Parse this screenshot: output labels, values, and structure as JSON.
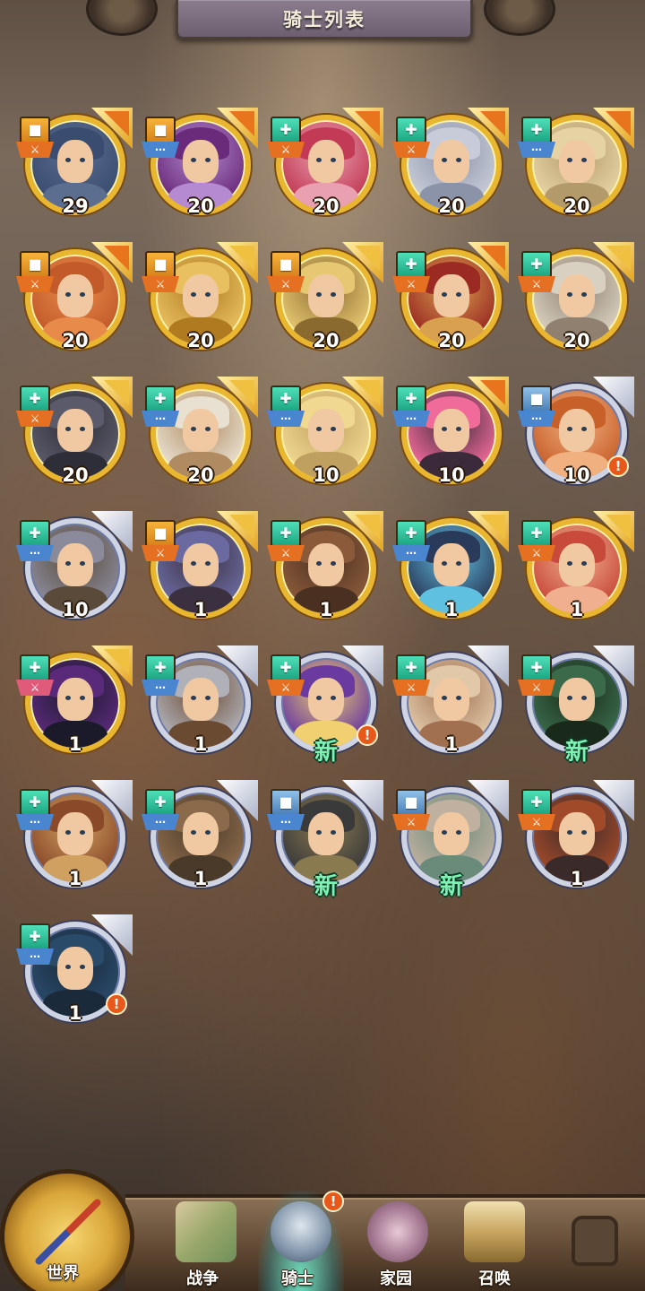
{
  "header": {
    "title": "骑士列表"
  },
  "knights": [
    {
      "level": "29",
      "frame": "gold",
      "class": "gold",
      "role": "orange",
      "corner": "orange",
      "alert": false
    },
    {
      "level": "20",
      "frame": "gold",
      "class": "gold",
      "role": "blue",
      "corner": "orange",
      "alert": false
    },
    {
      "level": "20",
      "frame": "gold",
      "class": "teal",
      "role": "orange",
      "corner": "orange",
      "alert": false
    },
    {
      "level": "20",
      "frame": "gold",
      "class": "teal",
      "role": "orange",
      "corner": "orange",
      "alert": false
    },
    {
      "level": "20",
      "frame": "gold",
      "class": "teal",
      "role": "blue",
      "corner": "orange",
      "alert": false
    },
    {
      "level": "20",
      "frame": "gold",
      "class": "gold",
      "role": "orange",
      "corner": "orange",
      "alert": false
    },
    {
      "level": "20",
      "frame": "gold",
      "class": "gold",
      "role": "orange",
      "corner": "yellow",
      "alert": false
    },
    {
      "level": "20",
      "frame": "gold",
      "class": "gold",
      "role": "orange",
      "corner": "yellow",
      "alert": false
    },
    {
      "level": "20",
      "frame": "gold",
      "class": "teal",
      "role": "orange",
      "corner": "orange",
      "alert": false
    },
    {
      "level": "20",
      "frame": "gold",
      "class": "teal",
      "role": "orange",
      "corner": "yellow",
      "alert": false
    },
    {
      "level": "20",
      "frame": "gold",
      "class": "teal",
      "role": "orange",
      "corner": "yellow",
      "alert": false
    },
    {
      "level": "20",
      "frame": "gold",
      "class": "teal",
      "role": "blue",
      "corner": "yellow",
      "alert": false
    },
    {
      "level": "10",
      "frame": "gold",
      "class": "teal",
      "role": "blue",
      "corner": "yellow",
      "alert": false
    },
    {
      "level": "10",
      "frame": "gold",
      "class": "teal",
      "role": "blue",
      "corner": "orange",
      "alert": false
    },
    {
      "level": "10",
      "frame": "blue",
      "class": "blue",
      "role": "blue",
      "corner": "none",
      "alert": true
    },
    {
      "level": "10",
      "frame": "blue",
      "class": "teal",
      "role": "blue",
      "corner": "none",
      "alert": false
    },
    {
      "level": "1",
      "frame": "gold",
      "class": "gold",
      "role": "orange",
      "corner": "yellow",
      "alert": false
    },
    {
      "level": "1",
      "frame": "gold",
      "class": "teal",
      "role": "orange",
      "corner": "yellow",
      "alert": false
    },
    {
      "level": "1",
      "frame": "gold",
      "class": "teal",
      "role": "blue",
      "corner": "yellow",
      "alert": false
    },
    {
      "level": "1",
      "frame": "gold",
      "class": "teal",
      "role": "orange",
      "corner": "yellow",
      "alert": false
    },
    {
      "level": "1",
      "frame": "gold",
      "class": "teal",
      "role": "pink",
      "corner": "yellow",
      "alert": false
    },
    {
      "level": "1",
      "frame": "blue",
      "class": "teal",
      "role": "blue",
      "corner": "none",
      "alert": false
    },
    {
      "level": "新",
      "frame": "blue",
      "class": "teal",
      "role": "orange",
      "corner": "none",
      "alert": true
    },
    {
      "level": "1",
      "frame": "blue",
      "class": "teal",
      "role": "orange",
      "corner": "none",
      "alert": false
    },
    {
      "level": "新",
      "frame": "blue",
      "class": "teal",
      "role": "orange",
      "corner": "none",
      "alert": false
    },
    {
      "level": "1",
      "frame": "blue",
      "class": "teal",
      "role": "blue",
      "corner": "none",
      "alert": false
    },
    {
      "level": "1",
      "frame": "blue",
      "class": "teal",
      "role": "blue",
      "corner": "none",
      "alert": false
    },
    {
      "level": "新",
      "frame": "blue",
      "class": "blue",
      "role": "blue",
      "corner": "none",
      "alert": false
    },
    {
      "level": "新",
      "frame": "blue",
      "class": "blue",
      "role": "orange",
      "corner": "none",
      "alert": false
    },
    {
      "level": "1",
      "frame": "blue",
      "class": "teal",
      "role": "orange",
      "corner": "none",
      "alert": false
    },
    {
      "level": "1",
      "frame": "blue",
      "class": "teal",
      "role": "blue",
      "corner": "none",
      "alert": true
    }
  ],
  "nav": {
    "world": "世界",
    "war": "战争",
    "knight": "骑士",
    "home": "家园",
    "summon": "召唤",
    "knight_alert": "!"
  }
}
